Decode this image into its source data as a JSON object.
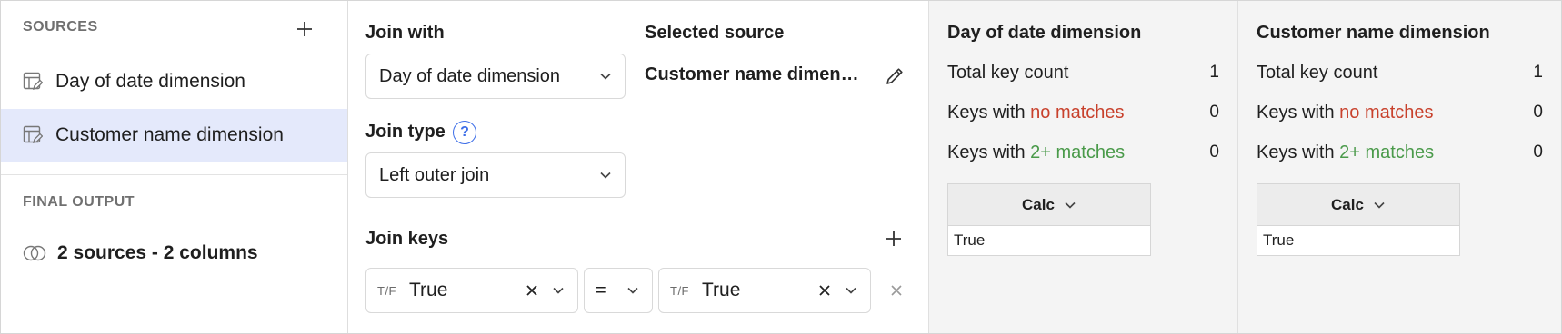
{
  "sources_panel": {
    "heading": "SOURCES",
    "items": [
      {
        "label": "Day of date dimension",
        "selected": false,
        "icon": "table-edit-icon"
      },
      {
        "label": "Customer name dimension",
        "selected": true,
        "icon": "table-edit-icon"
      }
    ],
    "final_output_heading": "FINAL OUTPUT",
    "final_output_label": "2 sources - 2 columns",
    "final_output_icon": "join-circles-icon"
  },
  "join_config": {
    "join_with_heading": "Join with",
    "join_with_value": "Day of date dimension",
    "selected_source_heading": "Selected source",
    "selected_source_value": "Customer name dimension",
    "join_type_heading": "Join type",
    "join_type_value": "Left outer join",
    "join_keys_heading": "Join keys",
    "keys": [
      {
        "left_type": "T/F",
        "left_value": "True",
        "operator": "=",
        "right_type": "T/F",
        "right_value": "True"
      }
    ]
  },
  "stat_panels": [
    {
      "title": "Day of date dimension",
      "total_label": "Total key count",
      "total_value": "1",
      "no_match_prefix": "Keys with",
      "no_match_highlight": "no matches",
      "no_match_value": "0",
      "multi_match_prefix": "Keys with",
      "multi_match_highlight": "2+ matches",
      "multi_match_value": "0",
      "column_header": "Calc",
      "cell_value": "True"
    },
    {
      "title": "Customer name dimension",
      "total_label": "Total key count",
      "total_value": "1",
      "no_match_prefix": "Keys with",
      "no_match_highlight": "no matches",
      "no_match_value": "0",
      "multi_match_prefix": "Keys with",
      "multi_match_highlight": "2+ matches",
      "multi_match_value": "0",
      "column_header": "Calc",
      "cell_value": "True"
    }
  ],
  "colors": {
    "selected_row_bg": "#e4e9fb",
    "no_matches": "#c8412c",
    "multi_matches": "#4a9a4a",
    "help_blue": "#3d6ee8"
  }
}
